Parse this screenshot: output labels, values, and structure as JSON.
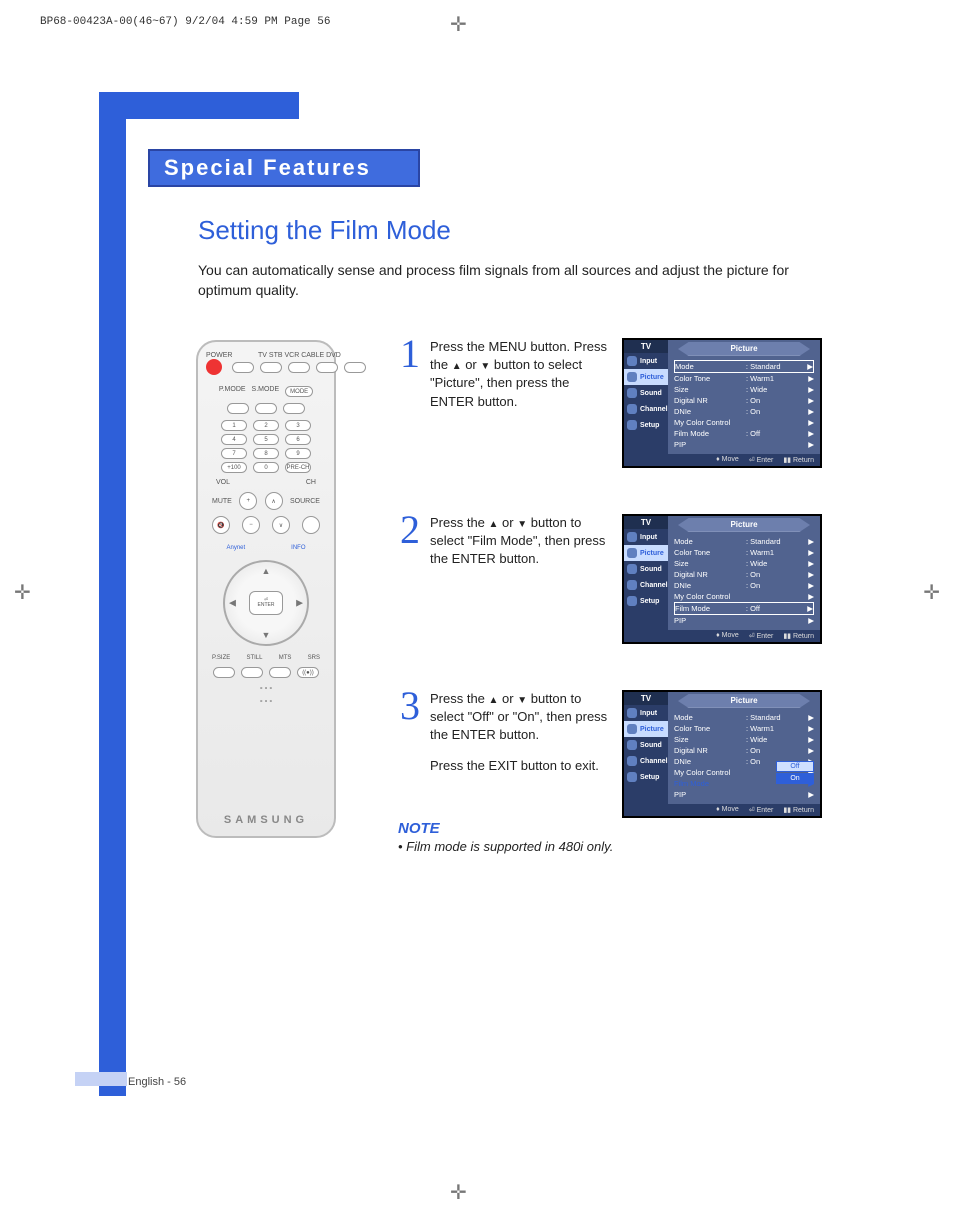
{
  "print_header": "BP68-00423A-00(46~67)  9/2/04  4:59 PM  Page 56",
  "chapter": "Special Features",
  "section": "Setting the Film Mode",
  "intro": "You can automatically sense and process film signals from all sources and adjust the picture for optimum quality.",
  "remote": {
    "power_label": "POWER",
    "device_row": "TV  STB  VCR  CABLE  DVD",
    "mode_row": [
      "P.MODE",
      "S.MODE",
      "MODE"
    ],
    "numpad": [
      [
        "1",
        "2",
        "3"
      ],
      [
        "4",
        "5",
        "6"
      ],
      [
        "7",
        "8",
        "9"
      ],
      [
        "+100",
        "0",
        "PRE-CH"
      ]
    ],
    "vol_ch": [
      "VOL",
      "CH"
    ],
    "mute_source": [
      "MUTE",
      "SOURCE"
    ],
    "enter": "ENTER",
    "bottom_labels": [
      "P.SIZE",
      "STILL",
      "MTS",
      "SRS"
    ],
    "brand": "SAMSUNG"
  },
  "steps": [
    {
      "num": "1",
      "text_parts": [
        "Press the MENU button. Press the ",
        " or ",
        " button to select \"Picture\", then press the ENTER button."
      ]
    },
    {
      "num": "2",
      "text_parts": [
        "Press the ",
        " or ",
        " button to select \"Film Mode\", then press the ENTER button."
      ]
    },
    {
      "num": "3",
      "text_parts": [
        "Press the ",
        " or ",
        " button to select \"Off\" or \"On\", then press the ENTER button."
      ],
      "extra": "Press the EXIT button to exit."
    }
  ],
  "osd_common": {
    "tv_label": "TV",
    "side_menu": [
      "Input",
      "Picture",
      "Sound",
      "Channel",
      "Setup"
    ],
    "title": "Picture",
    "rows": [
      {
        "k": "Mode",
        "v": ": Standard"
      },
      {
        "k": "Color Tone",
        "v": ": Warm1"
      },
      {
        "k": "Size",
        "v": ": Wide"
      },
      {
        "k": "Digital NR",
        "v": ": On"
      },
      {
        "k": "DNIe",
        "v": ": On"
      },
      {
        "k": "My Color Control",
        "v": ""
      },
      {
        "k": "Film Mode",
        "v": ": Off"
      },
      {
        "k": "PIP",
        "v": ""
      }
    ],
    "foot": [
      "Move",
      "Enter",
      "Return"
    ]
  },
  "osd3_options": [
    "Off",
    "On"
  ],
  "note": {
    "heading": "NOTE",
    "bullet": "• Film mode is supported in 480i only."
  },
  "footer": "English - 56"
}
